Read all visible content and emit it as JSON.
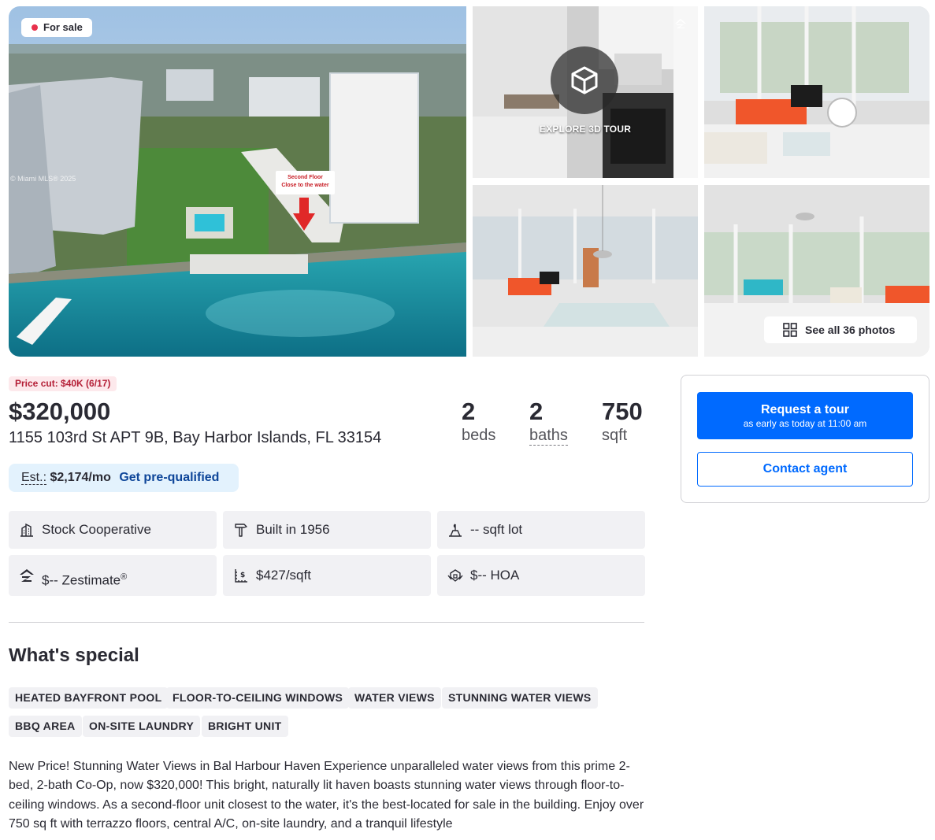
{
  "gallery": {
    "status_badge": "For sale",
    "watermark": "© Miami MLS® 2025",
    "callout_line1": "Second Floor",
    "callout_line2": "Close to the water",
    "tour_label": "EXPLORE 3D TOUR",
    "see_all_label": "See all 36 photos"
  },
  "listing": {
    "price_cut": "Price cut: $40K (6/17)",
    "price": "$320,000",
    "address": "1155 103rd St APT 9B, Bay Harbor Islands, FL 33154",
    "beds_value": "2",
    "beds_label": "beds",
    "baths_value": "2",
    "baths_label": "baths",
    "sqft_value": "750",
    "sqft_label": "sqft",
    "est_label": "Est.:",
    "est_payment": "$2,174/mo",
    "prequal_label": "Get pre-qualified"
  },
  "facts": {
    "type": "Stock Cooperative",
    "built": "Built in 1956",
    "lot": "-- sqft lot",
    "zestimate": "$-- Zestimate",
    "zestimate_mark": "®",
    "price_per_sqft": "$427/sqft",
    "hoa": "$-- HOA"
  },
  "special": {
    "title": "What's special",
    "tags": [
      "HEATED BAYFRONT POOL",
      "FLOOR-TO-CEILING WINDOWS",
      "WATER VIEWS",
      "STUNNING WATER VIEWS",
      "BBQ AREA",
      "ON-SITE LAUNDRY",
      "BRIGHT UNIT"
    ],
    "description": "New Price! Stunning Water Views in Bal Harbour Haven  Experience unparalleled water views from this prime 2-bed, 2-bath Co-Op, now $320,000! This bright, naturally lit haven boasts stunning water views through floor-to-ceiling windows. As a second-floor unit closest to the water, it's the best-located for sale in the building. Enjoy over 750 sq ft with terrazzo floors, central A/C, on-site laundry, and a tranquil lifestyle"
  },
  "contact": {
    "tour_button": "Request a tour",
    "tour_sub": "as early as today at 11:00 am",
    "contact_button": "Contact agent"
  },
  "colors": {
    "accent": "#006aff",
    "prequal_link": "#0d4599",
    "price_cut_bg": "#fde9ec",
    "price_cut_text": "#b41e36",
    "chip_bg": "#f1f1f4"
  },
  "icons": [
    "building-icon",
    "hammer-icon",
    "lot-icon",
    "zillow-icon",
    "price-sqft-icon",
    "hoa-icon",
    "cube-icon",
    "grid-icon"
  ]
}
